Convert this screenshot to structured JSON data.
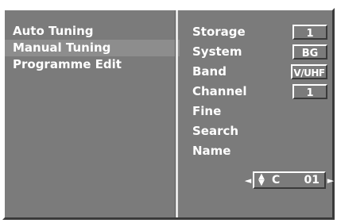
{
  "menu": {
    "items": [
      {
        "label": "Auto Tuning",
        "active": false
      },
      {
        "label": "Manual Tuning",
        "active": true
      },
      {
        "label": "Programme Edit",
        "active": false
      }
    ]
  },
  "params": [
    {
      "label": "Storage",
      "value": "1"
    },
    {
      "label": "System",
      "value": "BG"
    },
    {
      "label": "Band",
      "value": "V/UHF"
    },
    {
      "label": "Channel",
      "value": "1"
    },
    {
      "label": "Fine",
      "value": null
    },
    {
      "label": "Search",
      "value": null
    },
    {
      "label": "Name",
      "value": null
    }
  ],
  "tuner": {
    "band": "C",
    "channel": "01",
    "left_arrow": "◄",
    "right_arrow": "►",
    "up_glyph": "▲",
    "down_glyph": "▼"
  }
}
